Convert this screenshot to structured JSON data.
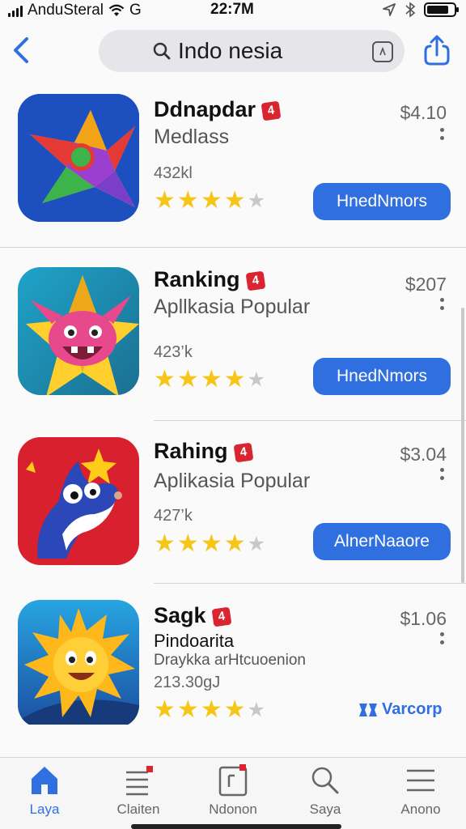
{
  "status_bar": {
    "carrier": "AnduSteral",
    "network": "G",
    "time": "22:7M"
  },
  "search": {
    "query": "Indo nesia"
  },
  "colors": {
    "accent": "#2f6fe0",
    "star": "#f5c518",
    "badge": "#d9252f"
  },
  "apps": [
    {
      "name": "Ddnapdar",
      "badge": "4",
      "subtitle": "Medlass",
      "size": "432kl",
      "rating": 4,
      "price": "$4.10",
      "action": "HnedNmors",
      "icon": "star-compass-app-icon"
    },
    {
      "name": "Ranking",
      "badge": "4",
      "subtitle": "Apllkasia Popular",
      "size": "423’k",
      "rating": 4,
      "price": "$207",
      "action": "HnedNmors",
      "icon": "monster-star-app-icon"
    },
    {
      "name": "Rahing",
      "badge": "4",
      "subtitle": "Aplikasia Popular",
      "size": "427’k",
      "rating": 4,
      "price": "$3.04",
      "action": "AlnerNaaore",
      "icon": "cartoon-shark-app-icon"
    },
    {
      "name": "Sagk",
      "badge": "4",
      "subtitle": "Pindoarita",
      "subtitle2": "Draykka arHtcuoenion",
      "size": "213.30gJ",
      "rating": 4,
      "price": "$1.06",
      "action": "Varcorp",
      "icon": "sun-character-app-icon"
    }
  ],
  "tabs": [
    {
      "label": "Laya",
      "icon": "home-icon",
      "active": true
    },
    {
      "label": "Claiten",
      "icon": "list-icon",
      "active": false
    },
    {
      "label": "Ndonon",
      "icon": "book-icon",
      "active": false
    },
    {
      "label": "Saya",
      "icon": "search-icon",
      "active": false
    },
    {
      "label": "Anono",
      "icon": "menu-icon",
      "active": false
    }
  ]
}
